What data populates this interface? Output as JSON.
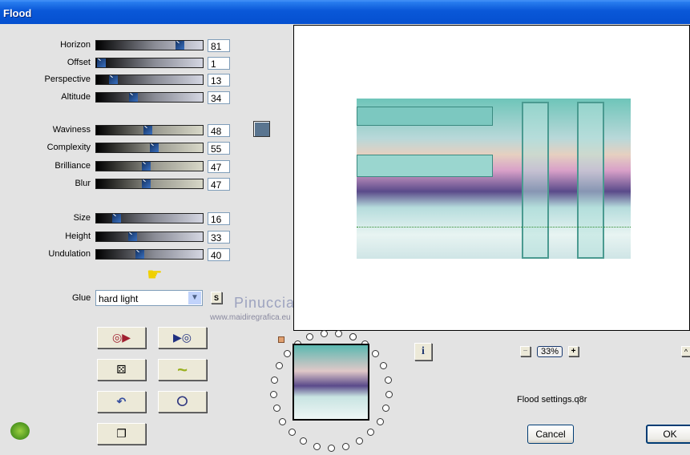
{
  "window": {
    "title": "Flood"
  },
  "sliders": [
    {
      "label": "Horizon",
      "value": 81,
      "style": "g1"
    },
    {
      "label": "Offset",
      "value": 1,
      "style": "g1"
    },
    {
      "label": "Perspective",
      "value": 13,
      "style": "g1"
    },
    {
      "label": "Altitude",
      "value": 34,
      "style": "g1"
    },
    {
      "label": "Waviness",
      "value": 48,
      "style": "g2"
    },
    {
      "label": "Complexity",
      "value": 55,
      "style": "g2"
    },
    {
      "label": "Brilliance",
      "value": 47,
      "style": "g2"
    },
    {
      "label": "Blur",
      "value": 47,
      "style": "g2"
    },
    {
      "label": "Size",
      "value": 16,
      "style": "g1"
    },
    {
      "label": "Height",
      "value": 33,
      "style": "g1"
    },
    {
      "label": "Undulation",
      "value": 40,
      "style": "g1"
    }
  ],
  "color_swatch": "#5a7590",
  "glue": {
    "label": "Glue",
    "value": "hard light",
    "s_button": "S"
  },
  "watermark": {
    "name": "Pinuccia",
    "url": "www.maidiregrafica.eu"
  },
  "zoom": {
    "minus": "−",
    "value": "33%",
    "plus": "+"
  },
  "info_button": "i",
  "scroll_up": "^",
  "settings_file": "Flood settings.q8r",
  "buttons": {
    "cancel": "Cancel",
    "ok": "OK"
  }
}
